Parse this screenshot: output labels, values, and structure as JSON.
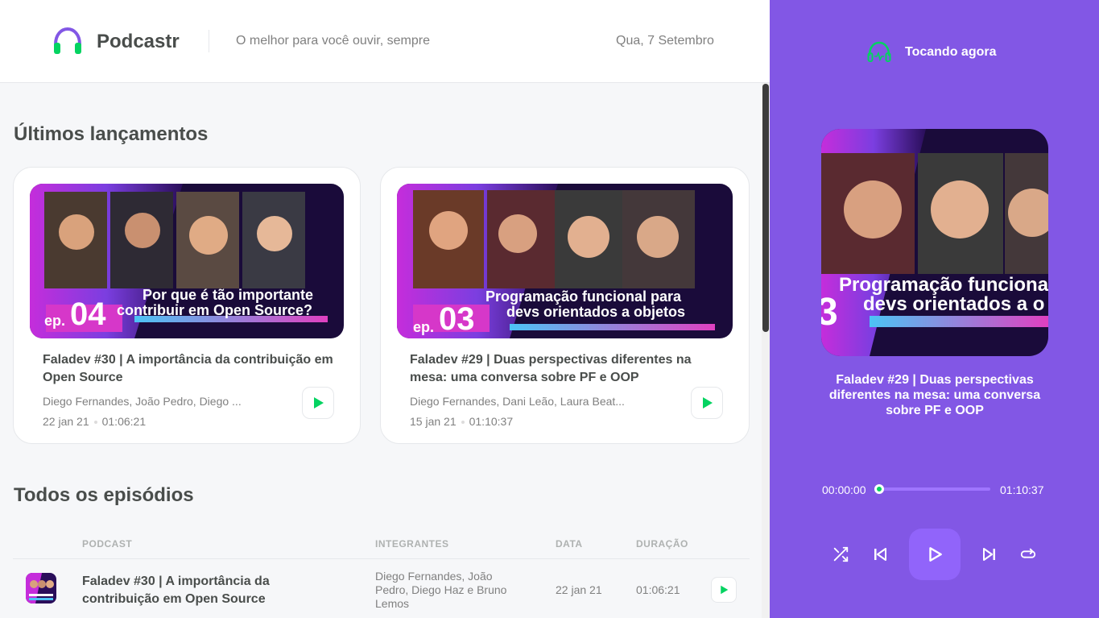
{
  "app": {
    "name": "Podcastr",
    "tagline": "O melhor para você ouvir, sempre",
    "date": "Qua, 7 Setembro"
  },
  "colors": {
    "brand": "#8257e5",
    "accent_green": "#04d361",
    "text": "#494d4b",
    "muted": "#808080"
  },
  "latest": {
    "title": "Últimos lançamentos",
    "episodes": [
      {
        "title": "Faladev #30 | A importância da contribuição em Open Source",
        "members": "Diego Fernandes, João Pedro, Diego ...",
        "date": "22 jan 21",
        "duration": "01:06:21",
        "thumb_ep": "04",
        "thumb_ep_prefix": "ep.",
        "thumb_caption_1": "Por que é tão importante",
        "thumb_caption_2": "contribuir em Open Source?"
      },
      {
        "title": "Faladev #29 | Duas perspectivas diferentes na mesa: uma conversa sobre PF e OOP",
        "members": "Diego Fernandes, Dani Leão, Laura Beat...",
        "date": "15 jan 21",
        "duration": "01:10:37",
        "thumb_ep": "03",
        "thumb_ep_prefix": "ep.",
        "thumb_caption_1": "Programação funcional para",
        "thumb_caption_2": "devs orientados a objetos"
      }
    ]
  },
  "all": {
    "title": "Todos os episódios",
    "columns": {
      "podcast": "Podcast",
      "members": "Integrantes",
      "date": "Data",
      "duration": "Duração"
    },
    "rows": [
      {
        "title": "Faladev #30 | A importância da contribuição em Open Source",
        "members": "Diego Fernandes, João Pedro, Diego Haz e Bruno Lemos",
        "date": "22 jan 21",
        "duration": "01:06:21"
      }
    ]
  },
  "player": {
    "label": "Tocando agora",
    "episode_title": "Faladev #29 | Duas perspectivas diferentes na mesa: uma conversa sobre PF e OOP",
    "cover_ep": "3",
    "cover_caption_1": "Programação funcional",
    "cover_caption_2": "devs orientados a o",
    "current_time": "00:00:00",
    "total_time": "01:10:37",
    "progress": 0,
    "icons": [
      "shuffle-icon",
      "play-previous-icon",
      "play-icon",
      "play-next-icon",
      "repeat-icon"
    ]
  }
}
